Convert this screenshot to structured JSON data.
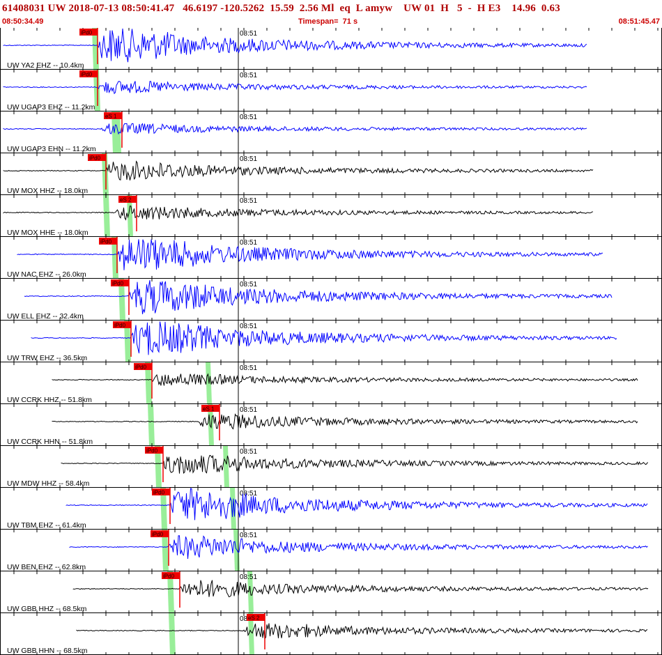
{
  "header": {
    "title": "61408031 UW 2018-07-13 08:50:41.47   46.6197 -120.5262  15.59  2.56 Ml  eq  L amyw    UW 01  H   5  -  H E3    14.96  0.63",
    "start_time": "08:50:34.49",
    "timespan": "Timespan=  71 s",
    "end_time": "08:51:45.47"
  },
  "time_tick_label": "08:51",
  "colors": {
    "blue_trace": "#0000ff",
    "black_trace": "#000000",
    "pick_red": "#ee0000",
    "green_band": "#99ee99",
    "header_red": "#cc0000"
  },
  "traces": [
    {
      "label": "UW YA2 EHZ -- 10.4km",
      "color": "blue",
      "amp": 1.0,
      "pick": "iPd0",
      "pick2": null
    },
    {
      "label": "UW UGAP3 EHZ -- 11.2km",
      "color": "blue",
      "amp": 0.35,
      "pick": "iPd0",
      "pick2": null
    },
    {
      "label": "UW UGAP3 EHN -- 11.2km",
      "color": "blue",
      "amp": 0.3,
      "pick": null,
      "pick2": "eS 1"
    },
    {
      "label": "UW MOX HHZ -- 18.0km",
      "color": "black",
      "amp": 0.55,
      "pick": "iPd0",
      "pick2": null
    },
    {
      "label": "UW MOX HHE -- 18.0km",
      "color": "black",
      "amp": 0.4,
      "pick": null,
      "pick2": "eS 2"
    },
    {
      "label": "UW NAC EHZ -- 26.0km",
      "color": "blue",
      "amp": 1.0,
      "pick": "iPd0",
      "pick2": null
    },
    {
      "label": "UW ELL EHZ -- 32.4km",
      "color": "blue",
      "amp": 1.0,
      "pick": "iPd0",
      "pick2": null
    },
    {
      "label": "UW TRW EHZ -- 36.5km",
      "color": "blue",
      "amp": 1.0,
      "pick": "iPd0",
      "pick2": null
    },
    {
      "label": "UW CCRK HHZ -- 51.8km",
      "color": "black",
      "amp": 0.35,
      "pick": "iPd0",
      "pick2": null
    },
    {
      "label": "UW CCRK HHN -- 51.8km",
      "color": "black",
      "amp": 0.45,
      "pick": null,
      "pick2": "eS 1"
    },
    {
      "label": "UW MDW HHZ -- 58.4km",
      "color": "black",
      "amp": 0.6,
      "pick": "iPd0",
      "pick2": null
    },
    {
      "label": "UW TBM EHZ -- 61.4km",
      "color": "blue",
      "amp": 0.95,
      "pick": "iPd0",
      "pick2": null
    },
    {
      "label": "UW BEN EHZ -- 62.8km",
      "color": "blue",
      "amp": 0.65,
      "pick": "iPd0",
      "pick2": null
    },
    {
      "label": "UW GBB HHZ -- 68.5km",
      "color": "black",
      "amp": 0.5,
      "pick": "iPd0",
      "pick2": null
    },
    {
      "label": "UW GBB HHN -- 68.5km",
      "color": "black",
      "amp": 0.45,
      "pick": null,
      "pick2": "eS 2"
    }
  ]
}
